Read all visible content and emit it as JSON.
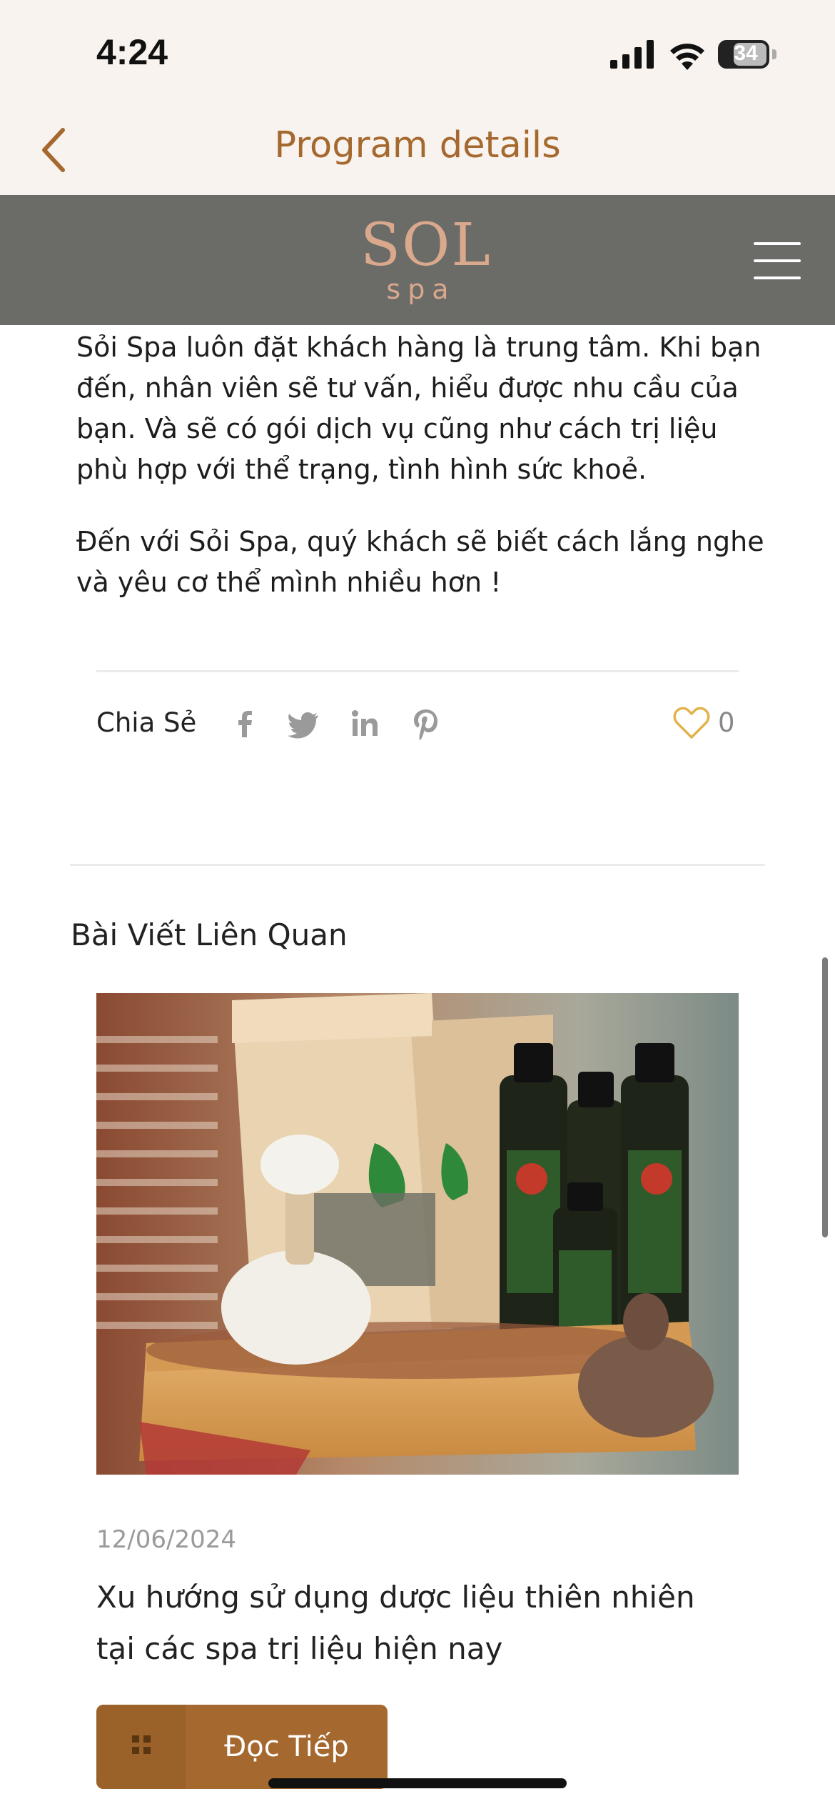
{
  "status_bar": {
    "time": "4:24",
    "battery": "34"
  },
  "nav": {
    "title": "Program details"
  },
  "site_header": {
    "logo_text": "SOL",
    "logo_sub": "spa"
  },
  "article": {
    "paragraphs": [
      "Sỏi Spa luôn đặt khách hàng là trung tâm. Khi bạn đến, nhân viên sẽ tư vấn, hiểu được nhu cầu của bạn. Và sẽ có gói dịch vụ cũng như cách trị liệu phù hợp với thể trạng, tình hình sức khoẻ.",
      "Đến với Sỏi Spa, quý khách sẽ biết cách lắng nghe và yêu cơ thể mình nhiều hơn !"
    ]
  },
  "share": {
    "label": "Chia Sẻ",
    "icons": [
      "facebook-icon",
      "twitter-icon",
      "linkedin-icon",
      "pinterest-icon"
    ],
    "like_count": "0"
  },
  "related": {
    "title": "Bài Viết Liên Quan",
    "post": {
      "date": "12/06/2024",
      "title": "Xu hướng sử dụng dược liệu thiên nhiên tại các spa trị liệu hiện nay",
      "read_more": "Đọc Tiếp"
    }
  },
  "colors": {
    "accent": "#a5692f",
    "header_bg": "#6b6b68",
    "page_bg": "#f8f3ee"
  }
}
